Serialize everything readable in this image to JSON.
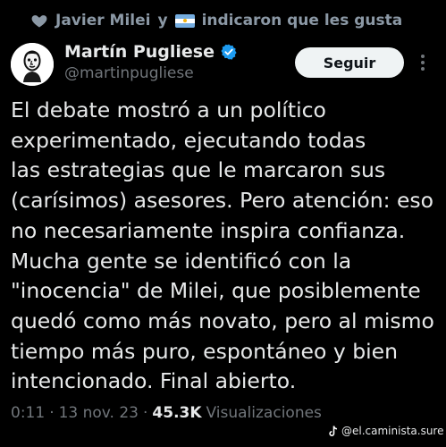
{
  "social_context": {
    "user_name": "Javier Milei",
    "connector": "y",
    "action_text": "indicaron que les gusta"
  },
  "author": {
    "display_name": "Martín Pugliese",
    "handle": "@martinpugliese",
    "verified": true
  },
  "follow_button_label": "Seguir",
  "tweet_lines": [
    "El debate mostró a un político",
    "experimentado, ejecutando todas",
    "las estrategias que le marcaron sus",
    "(carísimos) asesores. Pero atención: eso",
    "no necesariamente inspira confianza.",
    "Mucha gente se identificó con la",
    "\"inocencia\" de Milei, que posiblemente",
    "quedó como más novato, pero al mismo",
    "tiempo más puro, espontáneo y bien",
    "intencionado. Final abierto."
  ],
  "meta": {
    "time": "0:11",
    "separator": "·",
    "date": "13 nov. 23",
    "views_count": "45.3K",
    "views_label": "Visualizaciones"
  },
  "watermark": {
    "handle": "@el.caminista.sure"
  },
  "colors": {
    "background": "#000000",
    "primary_text": "#e7e9ea",
    "secondary_text": "#71767b",
    "verified_blue": "#1d9bf0",
    "button_bg": "#eff3f4"
  },
  "icons": {
    "social_context": "heart-icon",
    "flag": "argentina-flag-icon",
    "verified": "verified-badge-icon",
    "more": "more-vertical-icon",
    "watermark": "tiktok-icon"
  }
}
